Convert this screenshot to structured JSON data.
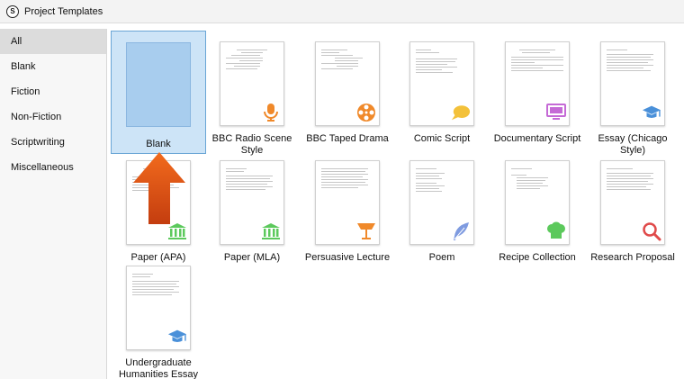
{
  "window": {
    "title": "Project Templates"
  },
  "sidebar": {
    "items": [
      {
        "label": "All"
      },
      {
        "label": "Blank"
      },
      {
        "label": "Fiction"
      },
      {
        "label": "Non-Fiction"
      },
      {
        "label": "Scriptwriting"
      },
      {
        "label": "Miscellaneous"
      }
    ],
    "selected": "All"
  },
  "templates": [
    {
      "label": "Blank",
      "icon": "blank-page-icon"
    },
    {
      "label": "BBC Radio Scene Style",
      "icon": "microphone-icon",
      "color": "#f0892a"
    },
    {
      "label": "BBC Taped Drama",
      "icon": "film-reel-icon",
      "color": "#f0892a"
    },
    {
      "label": "Comic Script",
      "icon": "speech-bubble-icon",
      "color": "#f3c13a"
    },
    {
      "label": "Documentary Script",
      "icon": "monitor-icon",
      "color": "#c56ad6"
    },
    {
      "label": "Essay (Chicago Style)",
      "icon": "graduation-cap-icon",
      "color": "#4a90d9"
    },
    {
      "label": "Paper (APA)",
      "icon": "institution-icon",
      "color": "#5cc95c"
    },
    {
      "label": "Paper (MLA)",
      "icon": "institution-icon",
      "color": "#5cc95c"
    },
    {
      "label": "Persuasive Lecture",
      "icon": "lectern-icon",
      "color": "#f0892a"
    },
    {
      "label": "Poem",
      "icon": "feather-icon",
      "color": "#7f9be0"
    },
    {
      "label": "Recipe Collection",
      "icon": "chef-hat-icon",
      "color": "#5cc95c"
    },
    {
      "label": "Research Proposal",
      "icon": "magnifier-icon",
      "color": "#e04a4a"
    },
    {
      "label": "Undergraduate Humanities Essay",
      "label_lines": [
        "Undergraduate",
        "Humanities Essay"
      ],
      "icon": "graduation-cap-icon",
      "color": "#4a90d9"
    }
  ],
  "selected_template": "Blank",
  "annotation": {
    "icon": "up-arrow-icon",
    "color": "#e5531a"
  }
}
